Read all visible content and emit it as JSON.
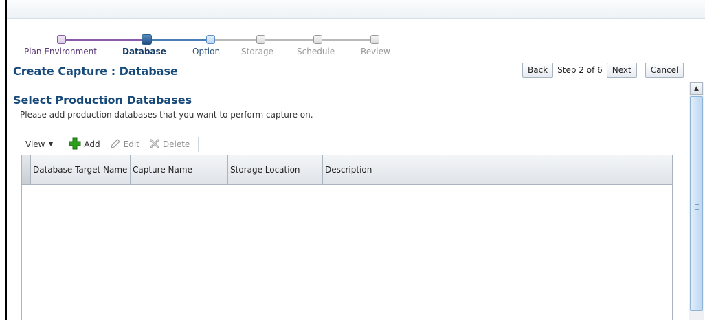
{
  "train": {
    "steps": [
      {
        "label": "Plan Environment",
        "state": "visited"
      },
      {
        "label": "Database",
        "state": "current"
      },
      {
        "label": "Option",
        "state": "next"
      },
      {
        "label": "Storage",
        "state": "disabled"
      },
      {
        "label": "Schedule",
        "state": "disabled"
      },
      {
        "label": "Review",
        "state": "disabled"
      }
    ]
  },
  "header": {
    "title": "Create Capture : Database",
    "back_label": "Back",
    "step_text": "Step 2 of 6",
    "next_label": "Next",
    "cancel_label": "Cancel"
  },
  "section": {
    "title": "Select Production Databases",
    "instructions": "Please add production databases that you want to perform capture on."
  },
  "toolbar": {
    "view_label": "View",
    "add_label": "Add",
    "edit_label": "Edit",
    "delete_label": "Delete"
  },
  "table": {
    "columns": [
      "Database Target Name",
      "Capture Name",
      "Storage Location",
      "Description"
    ],
    "rows": []
  },
  "colors": {
    "title": "#174a7a",
    "visited": "#8b5aa8",
    "current": "#1f4f83",
    "add_icon": "#2ca01c"
  }
}
